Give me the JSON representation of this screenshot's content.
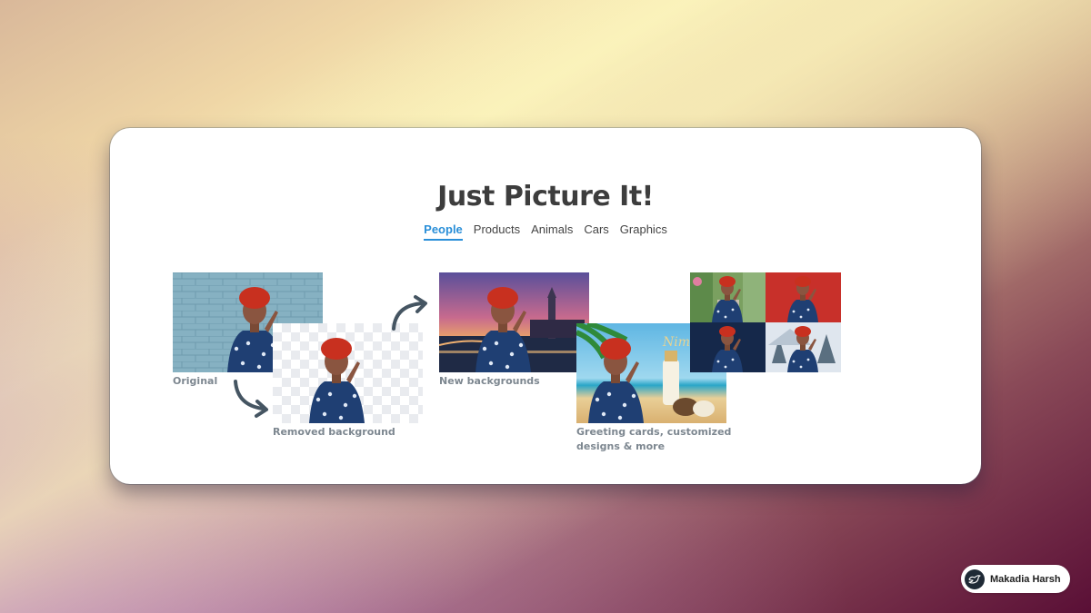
{
  "title": "Just Picture It!",
  "tabs": [
    {
      "label": "People",
      "active": true
    },
    {
      "label": "Products",
      "active": false
    },
    {
      "label": "Animals",
      "active": false
    },
    {
      "label": "Cars",
      "active": false
    },
    {
      "label": "Graphics",
      "active": false
    }
  ],
  "captions": {
    "original": "Original",
    "removed": "Removed background",
    "new_bg": "New backgrounds",
    "greeting_line1": "Greeting cards, customized",
    "greeting_line2": "designs & more"
  },
  "badge": {
    "name": "Makadia Harsh",
    "icon": "bird-icon"
  },
  "colors": {
    "accent": "#2a8fd8",
    "caption": "#7d8790",
    "title": "#3d3d3d"
  }
}
